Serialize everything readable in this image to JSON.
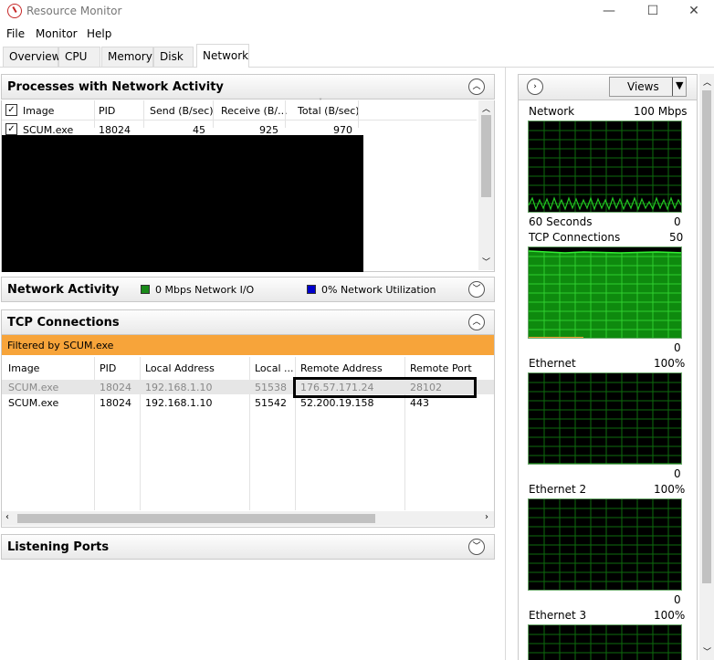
{
  "window": {
    "title": "Resource Monitor",
    "minimize": "—",
    "maximize": "☐",
    "close": "✕"
  },
  "menu": [
    "File",
    "Monitor",
    "Help"
  ],
  "tabs": [
    "Overview",
    "CPU",
    "Memory",
    "Disk",
    "Network"
  ],
  "active_tab": "Network",
  "processes": {
    "title": "Processes with Network Activity",
    "columns": [
      "Image",
      "PID",
      "Send (B/sec)",
      "Receive (B/...",
      "Total (B/sec)"
    ],
    "rows": [
      {
        "image": "SCUM.exe",
        "pid": "18024",
        "send": "45",
        "receive": "925",
        "total": "970",
        "checked": true
      }
    ]
  },
  "network_activity": {
    "title": "Network Activity",
    "io": "0 Mbps Network I/O",
    "util": "0% Network Utilization",
    "io_color": "#1a8a1a",
    "util_color": "#0000cc"
  },
  "tcp": {
    "title": "TCP Connections",
    "filter": "Filtered by SCUM.exe",
    "columns": [
      "Image",
      "PID",
      "Local Address",
      "Local ...",
      "Remote Address",
      "Remote Port"
    ],
    "rows": [
      {
        "image": "SCUM.exe",
        "pid": "18024",
        "local": "192.168.1.10",
        "lport": "51538",
        "remote": "176.57.171.24",
        "rport": "28102",
        "greyed": true
      },
      {
        "image": "SCUM.exe",
        "pid": "18024",
        "local": "192.168.1.10",
        "lport": "51542",
        "remote": "52.200.19.158",
        "rport": "443",
        "greyed": false
      }
    ]
  },
  "listening": {
    "title": "Listening Ports"
  },
  "side": {
    "views": "Views",
    "graphs": [
      {
        "name": "Network",
        "max": "100 Mbps",
        "foot_left": "60 Seconds",
        "foot_right": "0"
      },
      {
        "name": "TCP Connections",
        "max": "50",
        "foot_left": "",
        "foot_right": "0"
      },
      {
        "name": "Ethernet",
        "max": "100%",
        "foot_left": "",
        "foot_right": "0"
      },
      {
        "name": "Ethernet 2",
        "max": "100%",
        "foot_left": "",
        "foot_right": "0"
      },
      {
        "name": "Ethernet 3",
        "max": "100%",
        "foot_left": "",
        "foot_right": ""
      }
    ]
  },
  "colors": {
    "accent_orange": "#f7a43a",
    "graph_green": "#22c622",
    "graph_bg": "#000000"
  }
}
